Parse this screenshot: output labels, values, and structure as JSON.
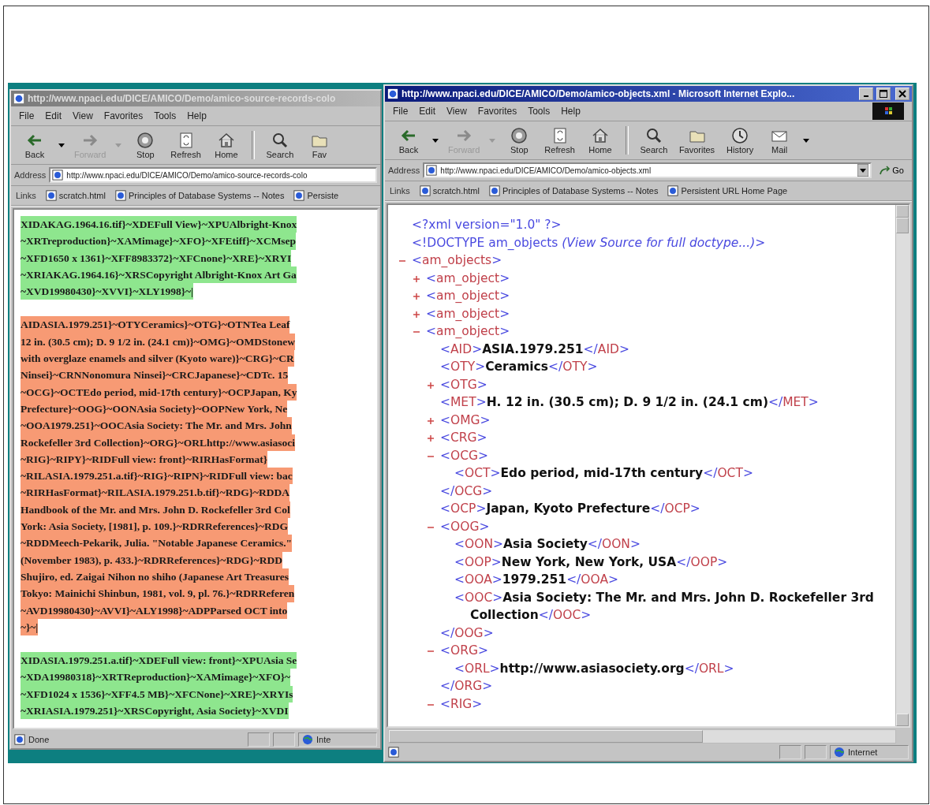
{
  "windows": [
    {
      "active": false,
      "title": "http://www.npaci.edu/DICE/AMICO/Demo/amico-source-records-colo",
      "menu": [
        "File",
        "Edit",
        "View",
        "Favorites",
        "Tools",
        "Help"
      ],
      "toolbar": [
        {
          "kind": "back",
          "label": "Back",
          "disabled": false,
          "dropdown": true
        },
        {
          "kind": "forward",
          "label": "Forward",
          "disabled": true,
          "dropdown": true
        },
        {
          "kind": "stop",
          "label": "Stop",
          "disabled": false
        },
        {
          "kind": "refresh",
          "label": "Refresh",
          "disabled": false
        },
        {
          "kind": "home",
          "label": "Home",
          "disabled": false
        },
        {
          "kind": "search",
          "label": "Search",
          "disabled": false
        },
        {
          "kind": "favorites",
          "label": "Fav",
          "disabled": false
        }
      ],
      "address_label": "Address",
      "address": "http://www.npaci.edu/DICE/AMICO/Demo/amico-source-records-colo",
      "links_label": "Links",
      "links": [
        "scratch.html",
        "Principles of Database Systems -- Notes",
        "Persiste"
      ],
      "content": {
        "kind": "records",
        "records": [
          {
            "color": "#8ee68e",
            "lines": [
              "XIDAKAG.1964.16.tif}~XDEFull View}~XPUAlbright-Knox",
              "~XRTreproduction}~XAMimage}~XFO}~XFEtiff}~XCMsep",
              "~XFD1650 x 1361}~XFF8983372}~XFCnone}~XRE}~XRYI",
              "~XRIAKAG.1964.16}~XRSCopyright Albright-Knox Art Ga",
              "~XVD19980430}~XVVI}~XLY1998}~|"
            ]
          },
          {
            "color": "#f79a74",
            "lines": [
              "AIDASIA.1979.251}~OTYCeramics}~OTG}~OTNTea Leaf",
              "12 in. (30.5 cm); D. 9 1/2 in. (24.1 cm)}~OMG}~OMDStonew",
              "with overglaze enamels and silver (Kyoto ware)}~CRG}~CR",
              "Ninsei}~CRNNonomura Ninsei}~CRCJapanese}~CDTc. 15",
              "~OCG}~OCTEdo period, mid-17th century}~OCPJapan, Ky",
              "Prefecture}~OOG}~OONAsia Society}~OOPNew York, Ne",
              "~OOA1979.251}~OOCAsia Society: The Mr. and Mrs. John",
              "Rockefeller 3rd Collection}~ORG}~ORLhttp://www.asiasoci",
              "~RIG}~RIPY}~RIDFull view: front}~RIRHasFormat}",
              "~RILASIA.1979.251.a.tif}~RIG}~RIPN}~RIDFull view: bac",
              "~RIRHasFormat}~RILASIA.1979.251.b.tif}~RDG}~RDDA",
              "Handbook of the Mr. and Mrs. John D. Rockefeller 3rd Col",
              "York: Asia Society, [1981], p. 109.}~RDRReferences}~RDG",
              "~RDDMeech-Pekarik, Julia. \"Notable Japanese Ceramics.\"",
              "(November 1983), p. 433.}~RDRReferences}~RDG}~RDD",
              "Shujiro, ed. Zaigai Nihon no shiho (Japanese Art Treasures",
              "Tokyo: Mainichi Shinbun, 1981, vol. 9, pl. 76.}~RDRReferen",
              "~AVD19980430}~AVVI}~ALY1998}~ADPParsed OCT into",
              "~}~|"
            ]
          },
          {
            "color": "#8ee68e",
            "lines": [
              "XIDASIA.1979.251.a.tif}~XDEFull view: front}~XPUAsia Se",
              "~XDA19980318}~XRTReproduction}~XAMimage}~XFO}~",
              "~XFD1024 x 1536}~XFF4.5 MB}~XFCNone}~XRE}~XRYIs",
              "~XRIASIA.1979.251}~XRSCopyright, Asia Society}~XVDI"
            ]
          }
        ]
      },
      "status": "Done",
      "zone": "Inte"
    },
    {
      "active": true,
      "title": "http://www.npaci.edu/DICE/AMICO/Demo/amico-objects.xml - Microsoft Internet Explo...",
      "menu": [
        "File",
        "Edit",
        "View",
        "Favorites",
        "Tools",
        "Help"
      ],
      "toolbar": [
        {
          "kind": "back",
          "label": "Back",
          "disabled": false,
          "dropdown": true
        },
        {
          "kind": "forward",
          "label": "Forward",
          "disabled": true,
          "dropdown": true
        },
        {
          "kind": "stop",
          "label": "Stop",
          "disabled": false
        },
        {
          "kind": "refresh",
          "label": "Refresh",
          "disabled": false
        },
        {
          "kind": "home",
          "label": "Home",
          "disabled": false
        },
        {
          "kind": "search",
          "label": "Search",
          "disabled": false
        },
        {
          "kind": "favorites",
          "label": "Favorites",
          "disabled": false
        },
        {
          "kind": "history",
          "label": "History",
          "disabled": false
        },
        {
          "kind": "mail",
          "label": "Mail",
          "disabled": false,
          "dropdown": true
        }
      ],
      "address_label": "Address",
      "address": "http://www.npaci.edu/DICE/AMICO/Demo/amico-objects.xml",
      "go": "Go",
      "links_label": "Links",
      "links": [
        "scratch.html",
        "Principles of Database Systems -- Notes",
        "Persistent URL Home Page"
      ],
      "content": {
        "kind": "xml",
        "tree": [
          {
            "kind": "pi",
            "text": "<?xml version=\"1.0\" ?>"
          },
          {
            "kind": "doctype",
            "text": "<!DOCTYPE am_objects *(View Source for full doctype...)*>"
          },
          {
            "kind": "element",
            "open": "<am_objects>",
            "expanded": true,
            "children": [
              {
                "kind": "element",
                "open": "<am_object>",
                "expanded": false
              },
              {
                "kind": "element",
                "open": "<am_object>",
                "expanded": false
              },
              {
                "kind": "element",
                "open": "<am_object>",
                "expanded": false
              },
              {
                "kind": "element",
                "open": "<am_object>",
                "expanded": true,
                "children": [
                  {
                    "kind": "element",
                    "open": "<AID>",
                    "text": "ASIA.1979.251",
                    "close": "</AID>"
                  },
                  {
                    "kind": "element",
                    "open": "<OTY>",
                    "text": "Ceramics",
                    "close": "</OTY>"
                  },
                  {
                    "kind": "element",
                    "open": "<OTG>",
                    "expanded": false
                  },
                  {
                    "kind": "element",
                    "open": "<MET>",
                    "text": "H. 12 in. (30.5 cm); D. 9 1/2 in. (24.1 cm)",
                    "close": "</MET>"
                  },
                  {
                    "kind": "element",
                    "open": "<OMG>",
                    "expanded": false
                  },
                  {
                    "kind": "element",
                    "open": "<CRG>",
                    "expanded": false
                  },
                  {
                    "kind": "element",
                    "open": "<OCG>",
                    "expanded": true,
                    "close": "</OCG>",
                    "children": [
                      {
                        "kind": "element",
                        "open": "<OCT>",
                        "text": "Edo period, mid-17th century",
                        "close": "</OCT>"
                      }
                    ]
                  },
                  {
                    "kind": "element",
                    "open": "<OCP>",
                    "text": "Japan, Kyoto Prefecture",
                    "close": "</OCP>"
                  },
                  {
                    "kind": "element",
                    "open": "<OOG>",
                    "expanded": true,
                    "close": "</OOG>",
                    "children": [
                      {
                        "kind": "element",
                        "open": "<OON>",
                        "text": "Asia Society",
                        "close": "</OON>"
                      },
                      {
                        "kind": "element",
                        "open": "<OOP>",
                        "text": "New York, New York, USA",
                        "close": "</OOP>"
                      },
                      {
                        "kind": "element",
                        "open": "<OOA>",
                        "text": "1979.251",
                        "close": "</OOA>"
                      },
                      {
                        "kind": "element",
                        "open": "<OOC>",
                        "text": "Asia Society: The Mr. and Mrs. John D. Rockefeller 3rd Collection",
                        "close": "</OOC>"
                      }
                    ]
                  },
                  {
                    "kind": "element",
                    "open": "<ORG>",
                    "expanded": true,
                    "close": "</ORG>",
                    "children": [
                      {
                        "kind": "element",
                        "open": "<ORL>",
                        "text": "http://www.asiasociety.org",
                        "close": "</ORL>"
                      }
                    ]
                  },
                  {
                    "kind": "element",
                    "open": "<RIG>",
                    "expanded": true
                  }
                ]
              }
            ]
          }
        ]
      },
      "zone": "Internet"
    }
  ]
}
